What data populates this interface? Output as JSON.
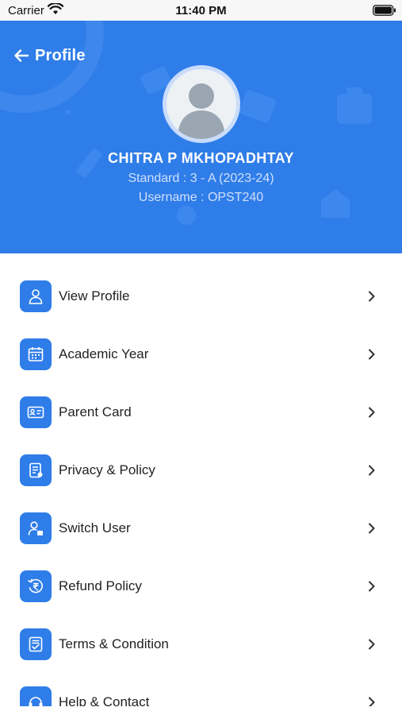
{
  "status_bar": {
    "carrier": "Carrier",
    "time": "11:40 PM"
  },
  "header": {
    "title": "Profile",
    "back_icon": "arrow-left-icon",
    "background_color": "#2f7de9"
  },
  "profile": {
    "name": "CHITRA P MKHOPADHTAY",
    "standard": "Standard : 3 - A (2023-24)",
    "username": "Username : OPST240",
    "avatar_icon": "user-placeholder-icon"
  },
  "menu": {
    "items": [
      {
        "label": "View Profile",
        "icon": "user-icon"
      },
      {
        "label": "Academic Year",
        "icon": "calendar-icon"
      },
      {
        "label": "Parent Card",
        "icon": "id-card-icon"
      },
      {
        "label": "Privacy & Policy",
        "icon": "document-icon"
      },
      {
        "label": "Switch User",
        "icon": "switch-user-icon"
      },
      {
        "label": "Refund Policy",
        "icon": "refund-icon"
      },
      {
        "label": "Terms & Condition",
        "icon": "terms-icon"
      },
      {
        "label": "Help & Contact",
        "icon": "help-icon"
      }
    ]
  },
  "colors": {
    "accent": "#2f7de9",
    "text": "#222222",
    "subtext": "#cfe0fb"
  }
}
